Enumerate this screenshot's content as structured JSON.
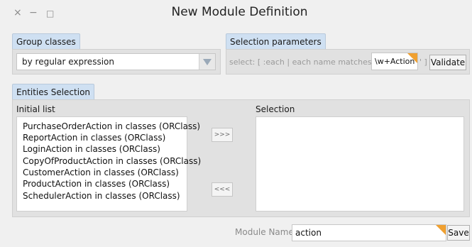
{
  "window": {
    "title": "New Module Definition",
    "controls": {
      "close": "×",
      "minimize": "−",
      "maximize": "□"
    }
  },
  "group_classes": {
    "tab_label": "Group classes",
    "selected_value": "by regular expression"
  },
  "selection_parameters": {
    "tab_label": "Selection parameters",
    "prefix_text": "select: [ :each | each name matches: '",
    "pattern_value": "\\w+Action",
    "suffix_text": "' ]",
    "validate_label": "Validate"
  },
  "entities_selection": {
    "tab_label": "Entities Selection",
    "initial_list_label": "Initial list",
    "selection_label": "Selection",
    "initial_items": [
      "PurchaseOrderAction in classes (ORClass)",
      "ReportAction in classes (ORClass)",
      "LoginAction in classes (ORClass)",
      "CopyOfProductAction in classes (ORClass)",
      "CustomerAction in classes (ORClass)",
      "ProductAction in classes (ORClass)",
      "SchedulerAction in classes (ORClass)"
    ],
    "selection_items": [],
    "add_button_label": ">>>",
    "remove_button_label": "<<<"
  },
  "module": {
    "name_label": "Module Name:",
    "name_value": "action",
    "save_label": "Save"
  },
  "colors": {
    "tab_bg": "#cfe0f2",
    "panel_bg": "#e1e1e1",
    "edited_corner": "#f0a030"
  }
}
